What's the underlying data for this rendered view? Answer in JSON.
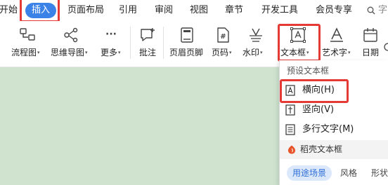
{
  "tabs": [
    {
      "label": "开始"
    },
    {
      "label": "插入"
    },
    {
      "label": "页面布局"
    },
    {
      "label": "引用"
    },
    {
      "label": "审阅"
    },
    {
      "label": "视图"
    },
    {
      "label": "章节"
    },
    {
      "label": "开发工具"
    },
    {
      "label": "会员专享"
    },
    {
      "label": "字"
    }
  ],
  "ribbon": {
    "buttons": [
      {
        "label": "流程图",
        "icon": "flowchart-icon",
        "has_caret": true
      },
      {
        "label": "思维导图",
        "icon": "mindmap-icon",
        "has_caret": true
      },
      {
        "label": "更多",
        "icon": "more-icon",
        "has_caret": true
      },
      {
        "label": "批注",
        "icon": "comment-icon",
        "has_caret": false
      },
      {
        "label": "页眉页脚",
        "icon": "header-footer-icon",
        "has_caret": false
      },
      {
        "label": "页码",
        "icon": "page-number-icon",
        "has_caret": true
      },
      {
        "label": "水印",
        "icon": "watermark-icon",
        "has_caret": true
      },
      {
        "label": "文本框",
        "icon": "textbox-icon",
        "has_caret": true
      },
      {
        "label": "艺术字",
        "icon": "wordart-icon",
        "has_caret": true
      },
      {
        "label": "日期",
        "icon": "calendar-icon",
        "has_caret": false
      }
    ],
    "caret": "▾",
    "more_glyph": "···",
    "page_number_glyph": "#"
  },
  "dropdown": {
    "header": "预设文本框",
    "items": [
      {
        "label": "横向(H)",
        "icon": "horizontal-textbox-icon"
      },
      {
        "label": "竖向(V)",
        "icon": "vertical-textbox-icon"
      },
      {
        "label": "多行文字(M)",
        "icon": "multiline-textbox-icon"
      }
    ],
    "daoke": {
      "label": "稻壳文本框",
      "icon": "daoke-icon"
    },
    "bottom_tabs": [
      "用途场景",
      "风格",
      "形状"
    ]
  },
  "colors": {
    "active_tab": "#3b82e8",
    "highlight": "#e53935",
    "document": "#cfe3cf",
    "pill_bg": "#dbe7fb",
    "pill_text": "#2d6fd6",
    "daoke": "#e8542a"
  }
}
